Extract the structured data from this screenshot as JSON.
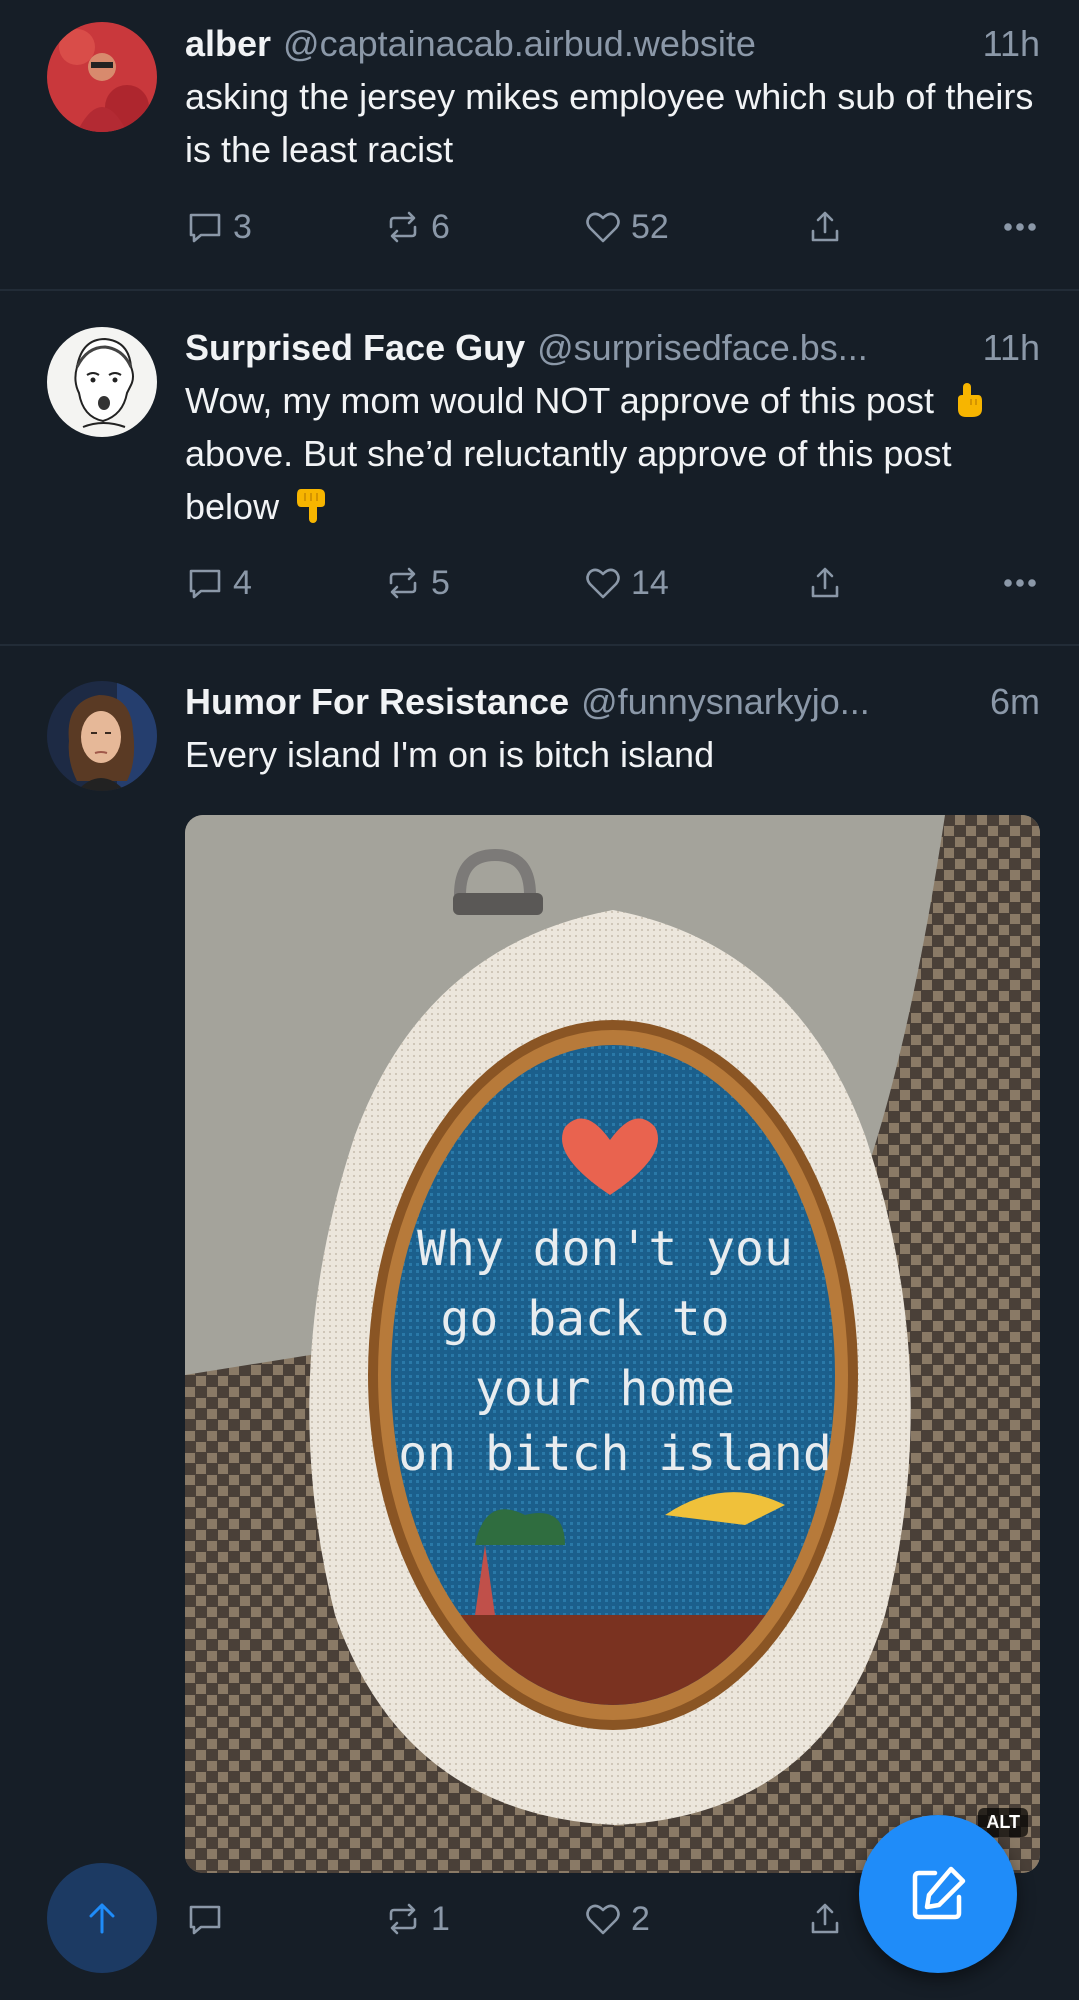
{
  "posts": [
    {
      "name": "alber",
      "handle": "@captainacab.airbud.website",
      "time": "11h",
      "text": "asking the jersey mikes employee which sub of theirs is the least racist",
      "replies": "3",
      "reposts": "6",
      "likes": "52"
    },
    {
      "name": "Surprised Face Guy",
      "handle": "@surprisedface.bs...",
      "time": "11h",
      "text_a": "Wow, my mom would NOT approve of this post",
      "text_b": "above. But she’d reluctantly approve of this post below",
      "replies": "4",
      "reposts": "5",
      "likes": "14"
    },
    {
      "name": "Humor For Resistance",
      "handle": "@funnysnarkyjo...",
      "time": "6m",
      "text": "Every island I'm on is bitch island",
      "image_text": [
        "Why don't you",
        "go back to",
        "your home",
        "on bitch island"
      ],
      "alt_badge": "ALT",
      "replies": "",
      "reposts": "1",
      "likes": "2"
    }
  ],
  "icons": {
    "reply": "speech-bubble-icon",
    "repost": "repost-arrows-icon",
    "like": "heart-icon",
    "share": "share-upload-icon",
    "more": "ellipsis-icon",
    "pointing_up": "hand-pointing-up-emoji",
    "pointing_down": "hand-pointing-down-emoji",
    "scroll_top": "arrow-up-icon",
    "compose": "pencil-square-icon"
  },
  "colors": {
    "background": "#161e27",
    "muted": "#8b98a8",
    "accent": "#1f8cf9"
  }
}
